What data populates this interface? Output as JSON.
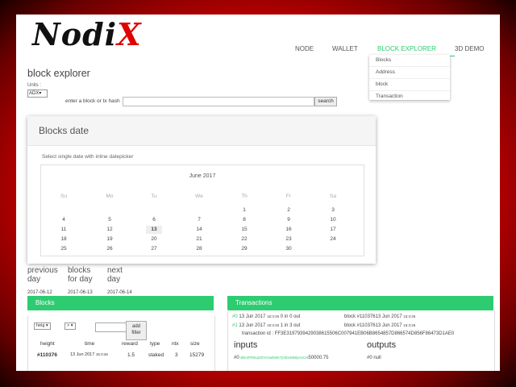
{
  "logo": {
    "text_main": "Nodi",
    "text_x": "X"
  },
  "nav": {
    "items": [
      "NODE",
      "WALLET",
      "BLOCK EXPLORER",
      "3D DEMO"
    ]
  },
  "dropdown": {
    "items": [
      "Blocks",
      "Address",
      "block",
      "Transaction"
    ]
  },
  "page_title": "block explorer",
  "units": {
    "label": "Units :",
    "value": "ADX"
  },
  "search": {
    "label": "enter a block or tx hash",
    "button": "search"
  },
  "card": {
    "title": "Blocks date",
    "subtitle": "Select single date with inline datepicker",
    "month": "June 2017",
    "dow": [
      "Su",
      "Mo",
      "Tu",
      "We",
      "Th",
      "Fr",
      "Sa"
    ],
    "weeks": [
      [
        "",
        "",
        "",
        "",
        "1",
        "2",
        "3"
      ],
      [
        "4",
        "5",
        "6",
        "7",
        "8",
        "9",
        "10"
      ],
      [
        "11",
        "12",
        "13",
        "14",
        "15",
        "16",
        "17"
      ],
      [
        "18",
        "19",
        "20",
        "21",
        "22",
        "23",
        "24"
      ],
      [
        "25",
        "26",
        "27",
        "28",
        "29",
        "30",
        ""
      ]
    ],
    "selected": "13"
  },
  "day_nav": {
    "previous_line1": "previous",
    "previous_line2": "day",
    "previous_date": "2017-06-12",
    "blocks_line1": "blocks",
    "blocks_line2": "for day",
    "blocks_date": "2017-06-13",
    "next_line1": "next",
    "next_line2": "day",
    "next_date": "2017-06-14"
  },
  "blocks_panel": {
    "title": "Blocks",
    "sort_select": "heig",
    "op_select": ">",
    "filter_button_line1": "add",
    "filter_button_line2": "filter",
    "headers": [
      "height",
      "time",
      "reward",
      "type",
      "ntx",
      "size"
    ],
    "row": {
      "height": "#110376",
      "time_date": "13 Jun 2017",
      "time_clock": "15:3:26",
      "reward": "1.5",
      "type": "staked",
      "ntx": "3",
      "size": "15279"
    }
  },
  "tx_panel": {
    "title": "Transactions",
    "tx1": {
      "idx": "#0",
      "date": "13 Jun 2017",
      "time": "15:3:26",
      "io": "0 in 0 out",
      "block": "block #11037613 Jun 2017",
      "block_time": "15:3:26"
    },
    "tx2": {
      "idx": "#1",
      "date": "13 Jun 2017",
      "time": "15:3:26",
      "io": "1 in 3 out",
      "block": "block #11037613 Jun 2017",
      "block_time": "15:3:26"
    },
    "txid_label": "transaction id :",
    "txid": "FF3E3197939429038615506C007941EB06B8654857D866574D856F86473D1AE0",
    "inputs_title": "inputs",
    "outputs_title": "outputs",
    "input0_idx": "#0",
    "input0_addr": "BEmPREq3XhVUwEMs7yrbbnMNipAm19",
    "input0_amount": "50000.75",
    "output0": "#0 null"
  },
  "colors": {
    "accent": "#2ecc71",
    "frame": "#d80000"
  }
}
